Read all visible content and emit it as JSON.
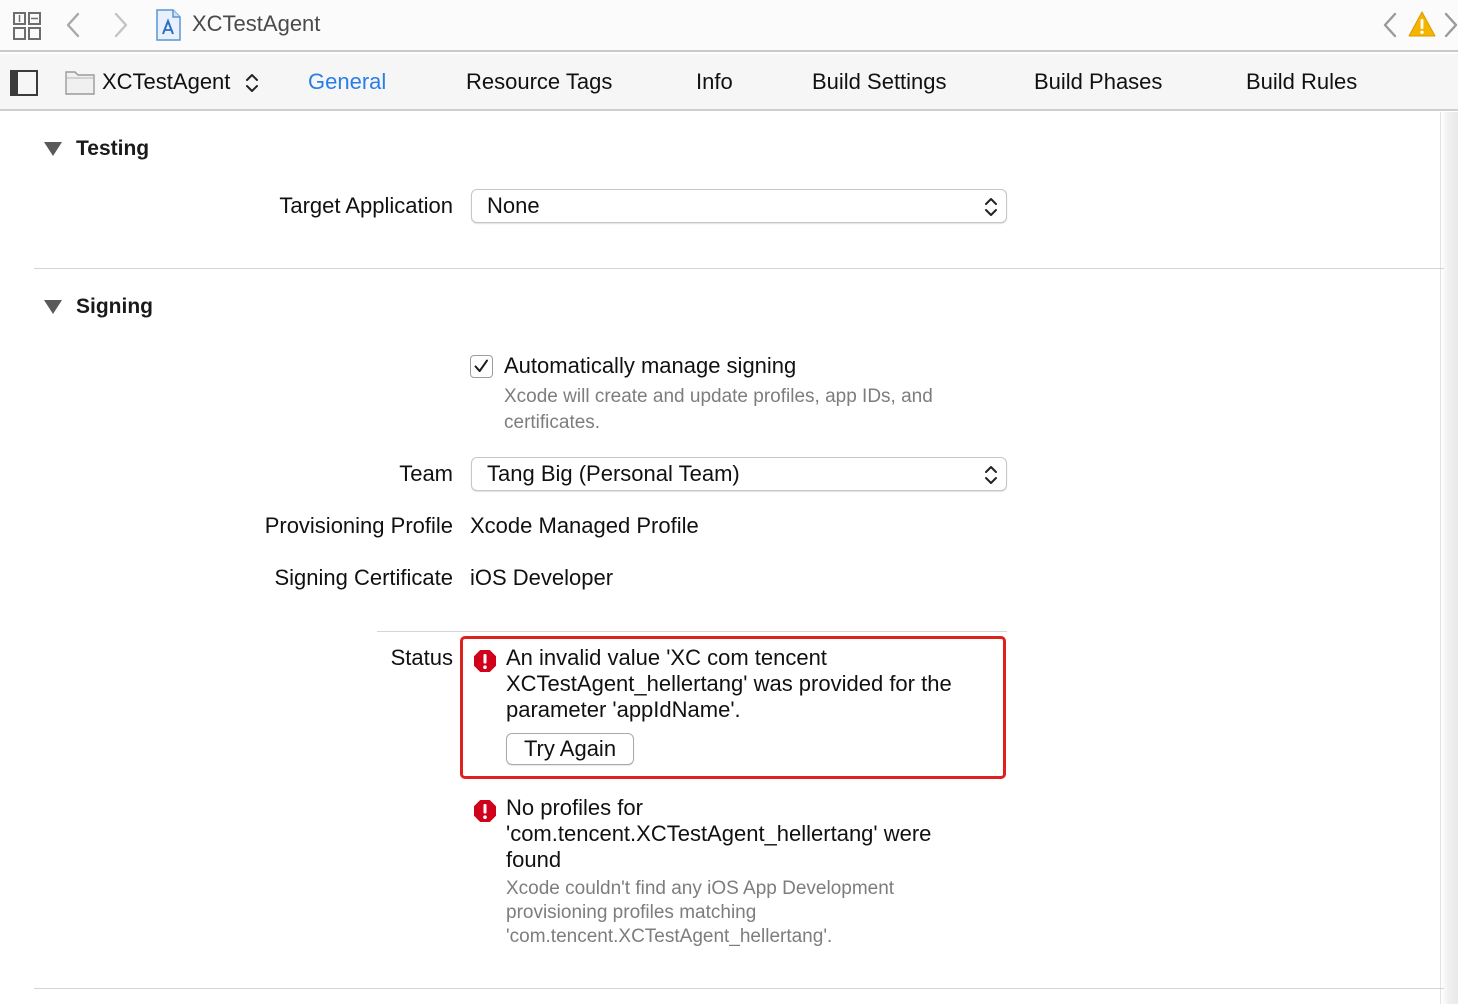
{
  "jump_bar": {
    "title": "XCTestAgent",
    "icons": [
      "grid-icon",
      "back-arrow-icon",
      "forward-arrow-icon",
      "project-file-icon",
      "previous-issue-icon",
      "warning-icon",
      "next-issue-icon"
    ]
  },
  "tab_bar": {
    "target_name": "XCTestAgent",
    "tabs": [
      {
        "label": "General",
        "active": true
      },
      {
        "label": "Resource Tags",
        "active": false
      },
      {
        "label": "Info",
        "active": false
      },
      {
        "label": "Build Settings",
        "active": false
      },
      {
        "label": "Build Phases",
        "active": false
      },
      {
        "label": "Build Rules",
        "active": false
      }
    ],
    "active_color": "#2a7ee8"
  },
  "testing": {
    "header": "Testing",
    "target_application_label": "Target Application",
    "target_application_value": "None"
  },
  "signing": {
    "header": "Signing",
    "auto_manage_checked": true,
    "auto_manage_label": "Automatically manage signing",
    "auto_manage_hint_line1": "Xcode will create and update profiles, app IDs, and",
    "auto_manage_hint_line2": "certificates.",
    "team_label": "Team",
    "team_value": "Tang Big (Personal Team)",
    "provisioning_profile_label": "Provisioning Profile",
    "provisioning_profile_value": "Xcode Managed Profile",
    "signing_certificate_label": "Signing Certificate",
    "signing_certificate_value": "iOS Developer",
    "status_label": "Status",
    "error1": {
      "line1": "An invalid value 'XC com tencent",
      "line2": "XCTestAgent_hellertang' was provided for the",
      "line3": "parameter 'appIdName'.",
      "button_label": "Try Again"
    },
    "error2": {
      "line1": "No profiles for",
      "line2": "'com.tencent.XCTestAgent_hellertang' were",
      "line3": "found",
      "hint_line1": "Xcode couldn't find any iOS App Development",
      "hint_line2": "provisioning profiles matching",
      "hint_line3": "'com.tencent.XCTestAgent_hellertang'."
    },
    "error_color": "#d0021b",
    "highlight_color": "#e0201f"
  }
}
